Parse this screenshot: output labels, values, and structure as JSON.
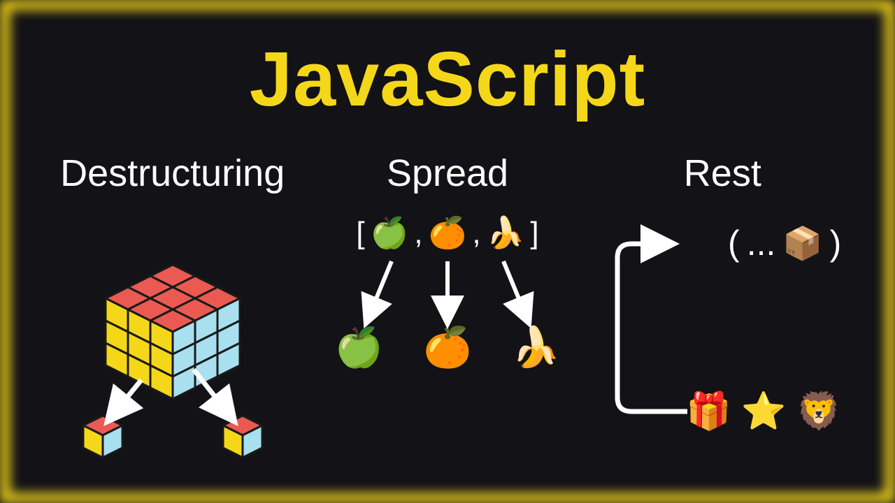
{
  "title": "JavaScript",
  "columns": [
    {
      "label": "Destructuring",
      "icon": "rubiks-cube"
    },
    {
      "label": "Spread",
      "icon": "fruit-array"
    },
    {
      "label": "Rest",
      "icon": "rest-params"
    }
  ],
  "spread": {
    "bracket_open": "[",
    "bracket_close": "]",
    "sep": ",",
    "items": [
      {
        "name": "green-apple",
        "glyph": "🍏"
      },
      {
        "name": "orange",
        "glyph": "🍊"
      },
      {
        "name": "banana",
        "glyph": "🍌"
      }
    ]
  },
  "rest": {
    "paren_open": "(",
    "paren_close": ")",
    "ellipsis": "...",
    "package_glyph": "📦",
    "items": [
      {
        "name": "gift",
        "glyph": "🎁"
      },
      {
        "name": "star",
        "glyph": "⭐"
      },
      {
        "name": "lion",
        "glyph": "🦁"
      }
    ]
  },
  "colors": {
    "accent": "#f5d71a",
    "bg": "#121217",
    "text": "#ffffff",
    "cube_red": "#ea5a52",
    "cube_yellow": "#f5d71a",
    "cube_blue": "#a8e0ef",
    "cube_stroke": "#1a1a1a"
  }
}
